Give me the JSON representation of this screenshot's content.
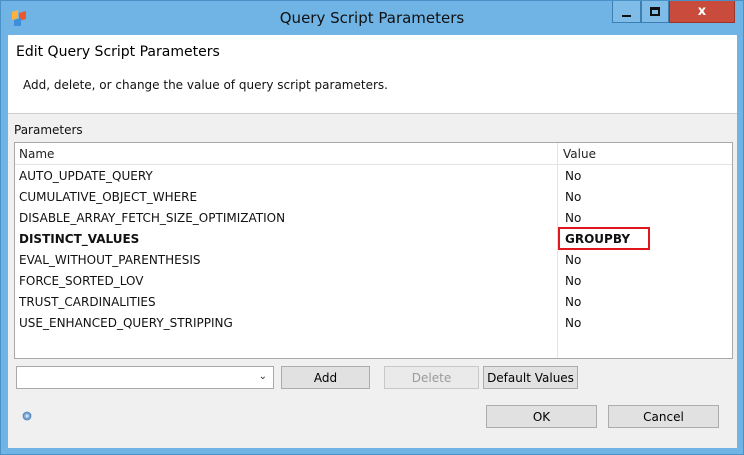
{
  "window": {
    "title": "Query Script Parameters",
    "controls": {
      "minimize": "–",
      "maximize": "□",
      "close": "x"
    },
    "icon": "app-logo-icon"
  },
  "header": {
    "title": "Edit Query Script Parameters",
    "description": "Add, delete, or change the value of query script parameters."
  },
  "parameters": {
    "label": "Parameters",
    "columns": {
      "name": "Name",
      "value": "Value"
    },
    "rows": [
      {
        "name": "AUTO_UPDATE_QUERY",
        "value": "No"
      },
      {
        "name": "CUMULATIVE_OBJECT_WHERE",
        "value": "No"
      },
      {
        "name": "DISABLE_ARRAY_FETCH_SIZE_OPTIMIZATION",
        "value": "No"
      },
      {
        "name": "DISTINCT_VALUES",
        "value": "GROUPBY",
        "bold": true,
        "highlighted": true
      },
      {
        "name": "EVAL_WITHOUT_PARENTHESIS",
        "value": "No"
      },
      {
        "name": "FORCE_SORTED_LOV",
        "value": "No"
      },
      {
        "name": "TRUST_CARDINALITIES",
        "value": "No"
      },
      {
        "name": "USE_ENHANCED_QUERY_STRIPPING",
        "value": "No"
      }
    ],
    "highlight_color": "#e0181e"
  },
  "toolbar": {
    "combo_value": "",
    "combo_arrow": "⌄",
    "add_label": "Add",
    "delete_label": "Delete",
    "default_values_label": "Default Values"
  },
  "footer": {
    "ok_label": "OK",
    "cancel_label": "Cancel",
    "help_icon": "help-icon"
  },
  "colors": {
    "titlebar": "#6fb4e4",
    "close_button": "#c94b3c",
    "dialog_bg": "#f0f0f0"
  }
}
